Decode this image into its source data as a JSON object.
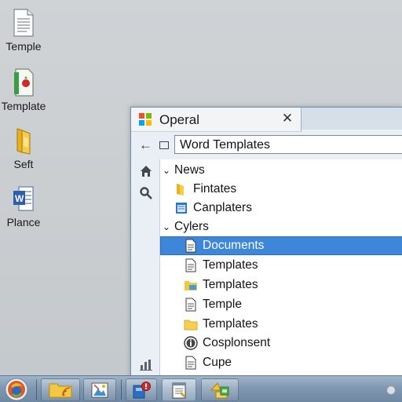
{
  "desktop": {
    "icons": [
      {
        "label": "Temple",
        "icon": "text-document-icon"
      },
      {
        "label": "Template",
        "icon": "green-spreadsheet-icon"
      },
      {
        "label": "Seft",
        "icon": "yellow-folder-icon"
      },
      {
        "label": "Plance",
        "icon": "word-document-icon"
      }
    ]
  },
  "window": {
    "title": "Operal",
    "close_glyph": "✕",
    "back_glyph": "←",
    "address": "Word Templates",
    "logo_colors": [
      "#f25022",
      "#7fba00",
      "#00a4ef",
      "#ffb900"
    ],
    "nav_icons": [
      "home-icon",
      "search-icon",
      "chart-icon"
    ],
    "tree": [
      {
        "label": "News",
        "chevron": "v",
        "icon": null,
        "selected": false
      },
      {
        "label": "Fintates",
        "chevron": "",
        "icon": "folder-icon",
        "selected": false
      },
      {
        "label": "Canplaters",
        "chevron": "",
        "icon": "list-window-icon",
        "selected": false
      },
      {
        "label": "Cylers",
        "chevron": "v",
        "icon": null,
        "selected": false
      },
      {
        "label": "Documents",
        "chevron": "",
        "icon": "document-icon",
        "selected": true
      },
      {
        "label": "Templates",
        "chevron": "",
        "icon": "document-icon",
        "selected": false
      },
      {
        "label": "Templates",
        "chevron": "",
        "icon": "folder-icon",
        "selected": false
      },
      {
        "label": "Temple",
        "chevron": "",
        "icon": "document-icon",
        "selected": false
      },
      {
        "label": "Templates",
        "chevron": "",
        "icon": "folder-icon",
        "selected": false
      },
      {
        "label": "Cosplonsent",
        "chevron": "",
        "icon": "info-icon",
        "selected": false
      },
      {
        "label": "Cupe",
        "chevron": "",
        "icon": "document-icon",
        "selected": false
      }
    ]
  },
  "taskbar": {
    "buttons": [
      "folder-icon",
      "picture-icon",
      "security-icon",
      "notepad-icon",
      "file-share-icon"
    ],
    "accent": "#3d86d9"
  }
}
